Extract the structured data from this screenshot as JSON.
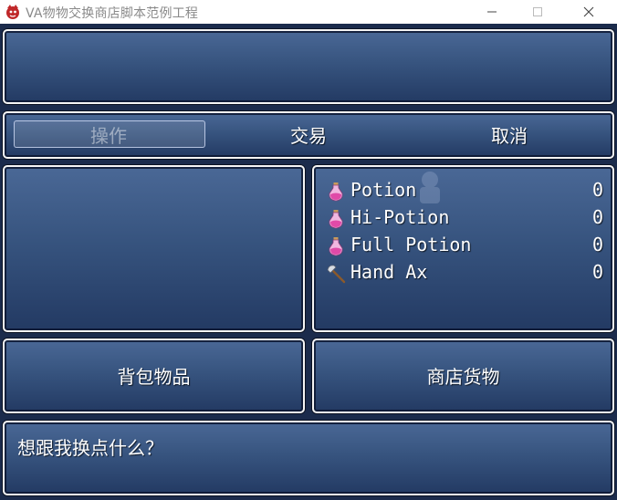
{
  "window": {
    "title": "VA物物交换商店脚本范例工程"
  },
  "commands": [
    {
      "label": "操作",
      "enabled": false,
      "selected": true
    },
    {
      "label": "交易",
      "enabled": true,
      "selected": false
    },
    {
      "label": "取消",
      "enabled": true,
      "selected": false
    }
  ],
  "items": [
    {
      "name": "Potion",
      "qty": "0",
      "icon": "potion-icon"
    },
    {
      "name": "Hi-Potion",
      "qty": "0",
      "icon": "potion-icon"
    },
    {
      "name": "Full Potion",
      "qty": "0",
      "icon": "potion-icon"
    },
    {
      "name": "Hand Ax",
      "qty": "0",
      "icon": "axe-icon"
    }
  ],
  "tabs": {
    "bag": "背包物品",
    "shop": "商店货物"
  },
  "message": "想跟我换点什么？",
  "colors": {
    "window_top": "#4a6896",
    "window_bottom": "#233a63",
    "border": "#f4f4f4"
  }
}
